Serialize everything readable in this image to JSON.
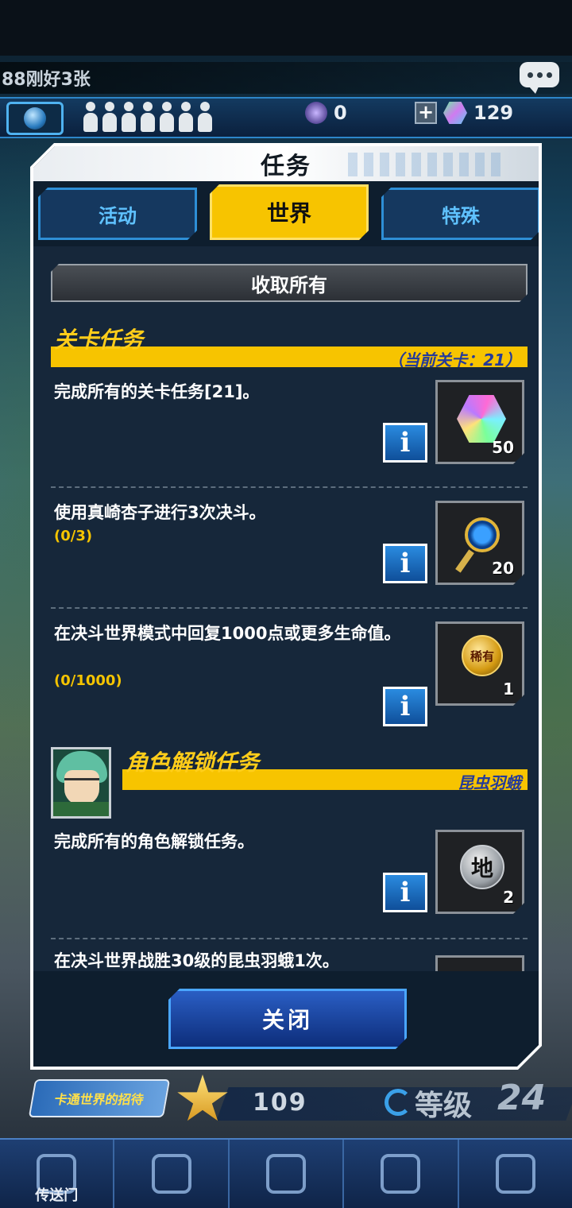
{
  "ticker": {
    "text": "88刚好3张"
  },
  "resources": {
    "orb_count": "0",
    "gem_count": "129"
  },
  "dialog": {
    "title": "任务",
    "tabs": [
      {
        "label": "活动",
        "active": false
      },
      {
        "label": "世界",
        "active": true
      },
      {
        "label": "特殊",
        "active": false
      }
    ],
    "claim_all_label": "收取所有",
    "stage_section": {
      "title": "关卡任务",
      "note": "（当前关卡：21）",
      "missions": [
        {
          "text": "完成所有的关卡任务[21]。",
          "progress": "",
          "reward_icon": "gem-icon",
          "reward_count": "50"
        },
        {
          "text": "使用真崎杏子进行3次决斗。",
          "progress": "(0/3)",
          "reward_icon": "key-icon",
          "reward_count": "20"
        },
        {
          "text": "在决斗世界模式中回复1000点或更多生命值。",
          "progress": "(0/1000)",
          "reward_icon": "medal-icon",
          "reward_count": "1",
          "reward_badge": "稀有"
        }
      ]
    },
    "unlock_section": {
      "title": "角色解锁任务",
      "note": "昆虫羽蛾",
      "missions": [
        {
          "text": "完成所有的角色解锁任务。",
          "progress": "",
          "reward_icon": "orb-icon",
          "reward_count": "2",
          "reward_badge": "地"
        },
        {
          "text": "在决斗世界战胜30级的昆虫羽蛾1次。",
          "progress": ""
        }
      ]
    },
    "close_label": "关闭"
  },
  "bottom": {
    "campaign_label": "卡通世界的招待",
    "level_points": "109",
    "level_label": "等级",
    "level_value": "24",
    "nav": [
      {
        "label": "传送门"
      },
      {
        "label": ""
      },
      {
        "label": ""
      },
      {
        "label": ""
      },
      {
        "label": ""
      }
    ]
  }
}
